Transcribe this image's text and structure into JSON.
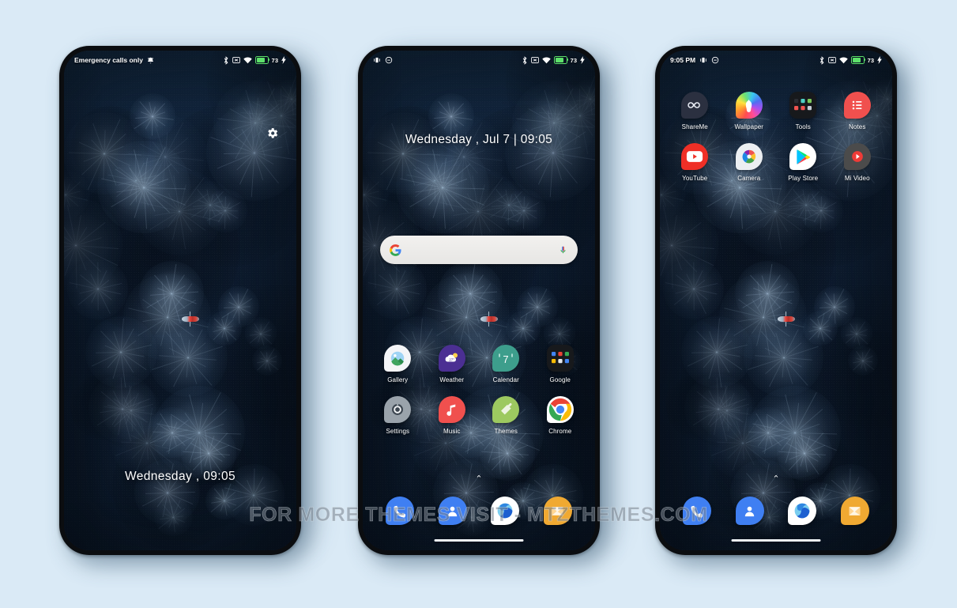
{
  "background_color": "#daeaf6",
  "watermark": "FOR MORE THEMES VISIT - MTZTHEMES.COM",
  "shared": {
    "battery_percent": "73",
    "status_icons": [
      "bluetooth-icon",
      "no-sim-icon",
      "wifi-icon",
      "battery-icon",
      "charging-bolt-icon"
    ]
  },
  "phones": [
    {
      "id": "lockscreen",
      "status_left": "Emergency calls only",
      "status_left_icon": "alarm-icon",
      "gear_icon": "gear-icon",
      "lock_clock": "Wednesday , 09:05"
    },
    {
      "id": "homescreen",
      "status_left_icons": [
        "vibrate-icon",
        "dnd-icon"
      ],
      "clock": "Wednesday , Jul 7  |  09:05",
      "search": {
        "value": "",
        "placeholder": "",
        "left_icon": "google-g-icon",
        "right_icon": "microphone-icon"
      },
      "apps": [
        {
          "label": "Gallery",
          "icon": "gallery-icon"
        },
        {
          "label": "Weather",
          "icon": "weather-icon"
        },
        {
          "label": "Calendar",
          "icon": "calendar-icon",
          "badge": "7"
        },
        {
          "label": "Google",
          "icon": "google-folder-icon"
        },
        {
          "label": "Settings",
          "icon": "settings-icon"
        },
        {
          "label": "Music",
          "icon": "music-icon"
        },
        {
          "label": "Themes",
          "icon": "themes-icon"
        },
        {
          "label": "Chrome",
          "icon": "chrome-icon"
        }
      ],
      "dock": [
        {
          "label": "Phone",
          "icon": "phone-icon"
        },
        {
          "label": "Contacts",
          "icon": "contacts-icon"
        },
        {
          "label": "Browser",
          "icon": "browser-icon"
        },
        {
          "label": "File Manager",
          "icon": "file-manager-icon"
        }
      ],
      "up_arrow": "⌃"
    },
    {
      "id": "homescreen-page2",
      "status_time": "9:05 PM",
      "status_left_icons": [
        "vibrate-icon",
        "dnd-icon"
      ],
      "apps": [
        {
          "label": "ShareMe",
          "icon": "shareme-icon"
        },
        {
          "label": "Wallpaper",
          "icon": "wallpaper-icon"
        },
        {
          "label": "Tools",
          "icon": "tools-folder-icon"
        },
        {
          "label": "Notes",
          "icon": "notes-icon"
        },
        {
          "label": "YouTube",
          "icon": "youtube-icon"
        },
        {
          "label": "Camera",
          "icon": "camera-icon"
        },
        {
          "label": "Play Store",
          "icon": "play-store-icon"
        },
        {
          "label": "Mi Video",
          "icon": "mi-video-icon"
        }
      ],
      "dock": [
        {
          "label": "Phone",
          "icon": "phone-icon"
        },
        {
          "label": "Contacts",
          "icon": "contacts-icon"
        },
        {
          "label": "Browser",
          "icon": "browser-icon"
        },
        {
          "label": "File Manager",
          "icon": "file-manager-icon"
        }
      ],
      "up_arrow": "⌃"
    }
  ]
}
